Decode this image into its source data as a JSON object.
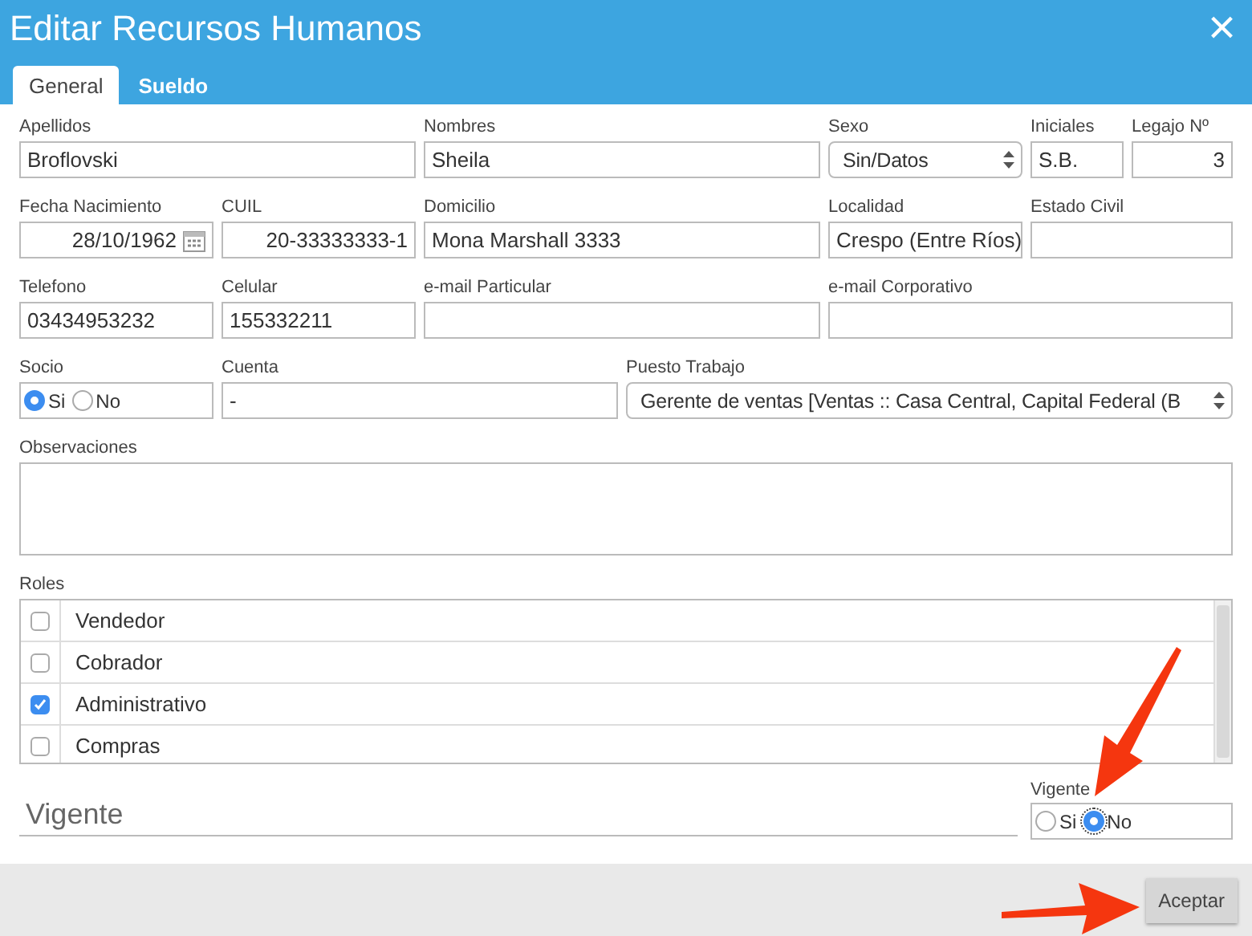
{
  "window": {
    "title": "Editar Recursos Humanos",
    "close": "×"
  },
  "tabs": [
    {
      "label": "General",
      "selected": true
    },
    {
      "label": "Sueldo",
      "selected": false
    }
  ],
  "rows": [
    [
      {
        "label": "Apellidos",
        "kind": "text",
        "value": "Broflovski"
      },
      {
        "label": "Nombres",
        "kind": "text",
        "value": "Sheila"
      },
      {
        "label": "Sexo",
        "kind": "select",
        "value": "Sin/Datos"
      },
      {
        "label": "Iniciales",
        "kind": "text",
        "value": "S.B."
      },
      {
        "label": "Legajo Nº",
        "kind": "numeric",
        "value": "3"
      }
    ],
    [
      {
        "label": "Fecha Nacimiento",
        "kind": "date",
        "value": "28/10/1962"
      },
      {
        "label": "CUIL",
        "kind": "numeric",
        "value": "20-33333333-1"
      },
      {
        "label": "Domicilio",
        "kind": "text",
        "value": "Mona Marshall 3333"
      },
      {
        "label": "Localidad",
        "kind": "text",
        "value": "Crespo (Entre Ríos)"
      },
      {
        "label": "Estado Civil",
        "kind": "text"
      }
    ],
    [
      {
        "label": "Telefono",
        "kind": "text",
        "value": "03434953232"
      },
      {
        "label": "Celular",
        "kind": "text",
        "value": "155332211"
      },
      {
        "label": "e-mail Particular",
        "kind": "text"
      },
      {
        "label": "e-mail Corporativo",
        "kind": "text"
      }
    ],
    [
      {
        "label": "Socio",
        "kind": "radio",
        "options": [
          {
            "label": "Si",
            "selected": true
          },
          {
            "label": "No",
            "selected": false
          }
        ]
      },
      {
        "label": "Cuenta",
        "kind": "text",
        "value": "-"
      },
      {
        "label": "Puesto Trabajo",
        "kind": "select",
        "value": "Gerente de ventas [Ventas :: Casa Central, Capital Federal (B"
      }
    ]
  ],
  "observaciones": {
    "label": "Observaciones"
  },
  "roles": {
    "label": "Roles",
    "items": [
      {
        "label": "Vendedor",
        "checked": false
      },
      {
        "label": "Cobrador",
        "checked": false
      },
      {
        "label": "Administrativo",
        "checked": true
      },
      {
        "label": "Compras",
        "checked": false
      }
    ]
  },
  "vigente_field": {
    "placeholder": "Vigente"
  },
  "vigente": {
    "label": "Vigente",
    "options": [
      {
        "label": "Si",
        "selected": false
      },
      {
        "label": "No",
        "selected": true
      }
    ]
  },
  "footer": {
    "button": "Aceptar"
  }
}
